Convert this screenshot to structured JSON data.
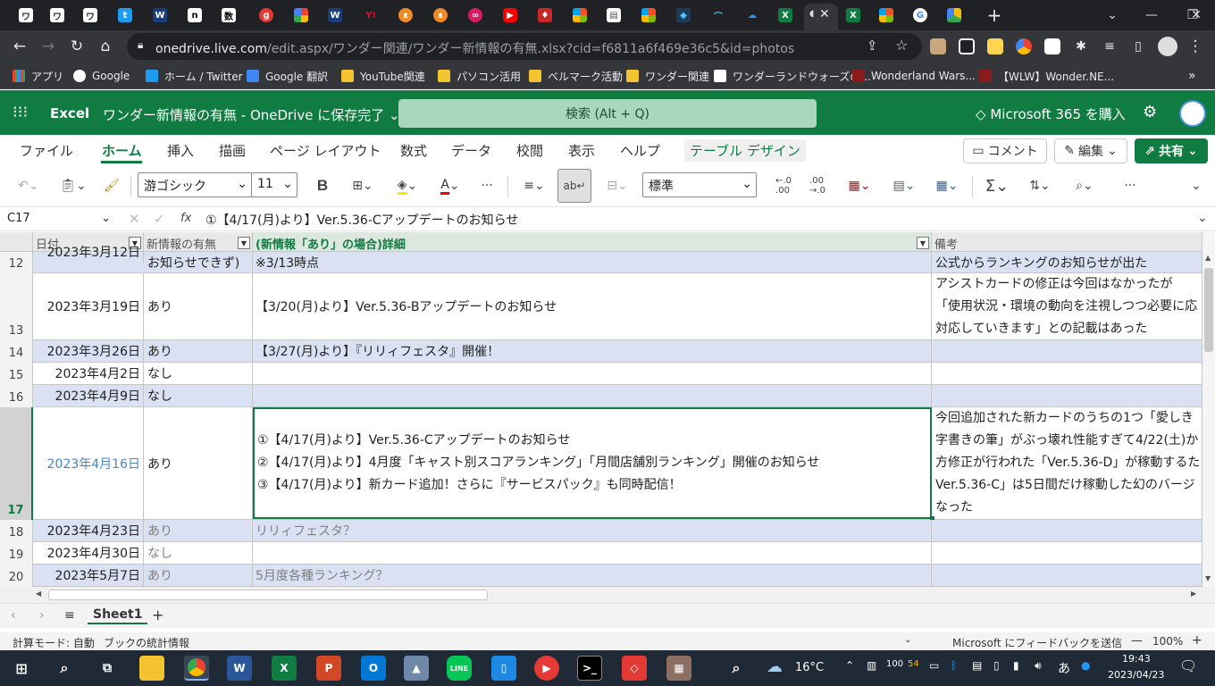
{
  "browser": {
    "url_host": "onedrive.live.com",
    "url_path": "/edit.aspx/ワンダー関連/ワンダー新情報の有無.xlsx?cid=f6811a6f469e36c5&id=photos",
    "new_tab_symbol": "+",
    "bookmarks": [
      {
        "label": "アプリ",
        "color": "#4285f4"
      },
      {
        "label": "Google",
        "color": "#ea4335"
      },
      {
        "label": "ホーム / Twitter",
        "color": "#1d9bf0"
      },
      {
        "label": "Google 翻訳",
        "color": "#4285f4"
      },
      {
        "label": "YouTube関連",
        "color": "#f4c430"
      },
      {
        "label": "パソコン活用",
        "color": "#f4c430"
      },
      {
        "label": "ベルマーク活動",
        "color": "#f4c430"
      },
      {
        "label": "ワンダー関連",
        "color": "#f4c430"
      },
      {
        "label": "ワンダーランドウォーズの...",
        "color": "#ffffff"
      },
      {
        "label": "Wonderland Wars...",
        "color": "#8b1a1a"
      },
      {
        "label": "【WLW】Wonder.NE...",
        "color": "#8b1a1a"
      }
    ]
  },
  "excel": {
    "app_name": "Excel",
    "doc_title": "ワンダー新情報の有無 - OneDrive に保存完了",
    "search_placeholder": "検索 (Alt + Q)",
    "m365_label": "Microsoft 365 を購入",
    "ribbon_tabs": [
      "ファイル",
      "ホーム",
      "挿入",
      "描画",
      "ページ レイアウト",
      "数式",
      "データ",
      "校閲",
      "表示",
      "ヘルプ",
      "テーブル デザイン"
    ],
    "comment_btn": "コメント",
    "edit_btn": "編集",
    "share_btn": "共有",
    "font_name": "游ゴシック",
    "font_size": "11",
    "number_format": "標準",
    "name_box": "C17",
    "formula": "①【4/17(月)より】Ver.5.36-Cアップデートのお知らせ",
    "columns": [
      "日付",
      "新情報の有無",
      "(新情報「あり」の場合)詳細",
      "備考"
    ],
    "rows": [
      {
        "num": "12",
        "date": "2023年3月12日",
        "has": "お知らせできず)",
        "detail": "※3/13時点",
        "note": "公式からランキングのお知らせが出た"
      },
      {
        "num": "13",
        "date": "2023年3月19日",
        "has": "あり",
        "detail": "【3/20(月)より】Ver.5.36-Bアップデートのお知らせ",
        "note_lines": [
          "アシストカードの修正は今回はなかったが",
          "「使用状況・環境の動向を注視しつつ必要に応",
          "対応していきます」との記載はあった"
        ]
      },
      {
        "num": "14",
        "date": "2023年3月26日",
        "has": "あり",
        "detail": "【3/27(月)より】『リリィフェスタ』開催！",
        "note": ""
      },
      {
        "num": "15",
        "date": "2023年4月2日",
        "has": "なし",
        "detail": "",
        "note": ""
      },
      {
        "num": "16",
        "date": "2023年4月9日",
        "has": "なし",
        "detail": "",
        "note": ""
      },
      {
        "num": "17",
        "date": "2023年4月16日",
        "has": "あり",
        "detail_lines": [
          "①【4/17(月)より】Ver.5.36-Cアップデートのお知らせ",
          "②【4/17(月)より】4月度「キャスト別スコアランキング」「月間店舗別ランキング」開催のお知らせ",
          "③【4/17(月)より】新カード追加！さらに『サービスパック』も同時配信！"
        ],
        "note_lines": [
          "今回追加された新カードのうちの1つ「愛しき",
          "字書きの筆」がぶっ壊れ性能すぎて4/22(土)か",
          "方修正が行われた「Ver.5.36-D」が稼動するた",
          "Ver.5.36-C」は5日間だけ稼動した幻のバージ",
          "なった"
        ]
      },
      {
        "num": "18",
        "date": "2023年4月23日",
        "has": "あり",
        "detail": "リリィフェスタ？",
        "note": ""
      },
      {
        "num": "19",
        "date": "2023年4月30日",
        "has": "なし",
        "detail": "",
        "note": ""
      },
      {
        "num": "20",
        "date": "2023年5月7日",
        "has": "あり",
        "detail": "5月度各種ランキング？",
        "note": ""
      }
    ],
    "sheet_tab": "Sheet1",
    "add_sheet": "+",
    "status_calc": "計算モード: 自動",
    "status_stats": "ブックの統計情報",
    "feedback": "Microsoft にフィードバックを送信",
    "zoom": "100%"
  },
  "taskbar": {
    "weather": "16°C",
    "ime": "あ",
    "time": "19:43",
    "date": "2023/04/23",
    "tray_num1": "100",
    "tray_num2": "54"
  },
  "colors": {
    "excel_green": "#107c41",
    "band_blue": "#d9e1f2"
  }
}
